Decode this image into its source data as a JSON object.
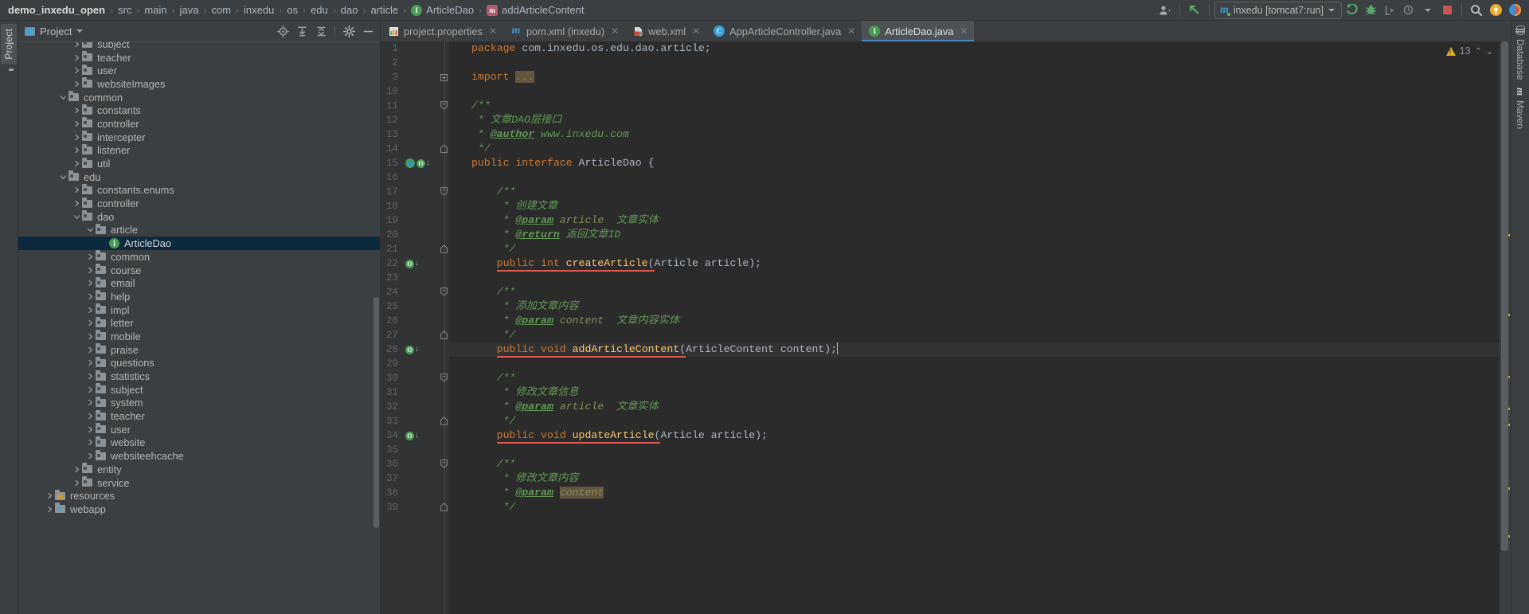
{
  "breadcrumb": {
    "items": [
      {
        "label": "demo_inxedu_open",
        "icon": "",
        "root": true
      },
      {
        "label": "src",
        "icon": ""
      },
      {
        "label": "main",
        "icon": ""
      },
      {
        "label": "java",
        "icon": ""
      },
      {
        "label": "com",
        "icon": ""
      },
      {
        "label": "inxedu",
        "icon": ""
      },
      {
        "label": "os",
        "icon": ""
      },
      {
        "label": "edu",
        "icon": ""
      },
      {
        "label": "dao",
        "icon": ""
      },
      {
        "label": "article",
        "icon": ""
      },
      {
        "label": "ArticleDao",
        "icon": "interface-icon",
        "glyph": "I"
      },
      {
        "label": "addArticleContent",
        "icon": "method-icon",
        "glyph": "m"
      }
    ],
    "separator": "›"
  },
  "toolbar": {
    "user_icon": "user-avatar-icon",
    "vcs_update_icon": "vcs-update-arrow-icon",
    "run_config": {
      "prefix_icon": "maven-icon",
      "label": "inxedu [tomcat7:run]",
      "dropdown": "▾"
    },
    "buttons": [
      {
        "name": "run-button",
        "glyph": "run"
      },
      {
        "name": "debug-button",
        "glyph": "debug"
      },
      {
        "name": "run-with-coverage-button",
        "glyph": "coverage"
      },
      {
        "name": "profile-button",
        "glyph": "profile"
      },
      {
        "name": "stop-button",
        "glyph": "stop"
      },
      {
        "name": "search-everywhere-button",
        "glyph": "search"
      },
      {
        "name": "update-button",
        "glyph": "update"
      },
      {
        "name": "feedback-button",
        "glyph": "colorwheel"
      }
    ]
  },
  "left_strip": {
    "tab_label": "Project",
    "folder_icon": "folder-icon"
  },
  "project_panel": {
    "title": "Project",
    "dropdown": "▾",
    "header_buttons": [
      {
        "name": "locate-button",
        "title": "Select Opened File"
      },
      {
        "name": "expand-all-button",
        "title": "Expand All"
      },
      {
        "name": "collapse-all-button",
        "title": "Collapse All"
      },
      {
        "name": "settings-button",
        "title": "Settings"
      },
      {
        "name": "hide-button",
        "title": "Hide"
      }
    ],
    "tree": [
      {
        "label": "subject",
        "indent": 4,
        "arrow": "right",
        "icon": "folder",
        "partial": true
      },
      {
        "label": "teacher",
        "indent": 4,
        "arrow": "right",
        "icon": "folder"
      },
      {
        "label": "user",
        "indent": 4,
        "arrow": "right",
        "icon": "folder"
      },
      {
        "label": "websiteImages",
        "indent": 4,
        "arrow": "right",
        "icon": "folder"
      },
      {
        "label": "common",
        "indent": 3,
        "arrow": "down",
        "icon": "folder"
      },
      {
        "label": "constants",
        "indent": 4,
        "arrow": "right",
        "icon": "folder"
      },
      {
        "label": "controller",
        "indent": 4,
        "arrow": "right",
        "icon": "folder"
      },
      {
        "label": "intercepter",
        "indent": 4,
        "arrow": "right",
        "icon": "folder"
      },
      {
        "label": "listener",
        "indent": 4,
        "arrow": "right",
        "icon": "folder"
      },
      {
        "label": "util",
        "indent": 4,
        "arrow": "right",
        "icon": "folder"
      },
      {
        "label": "edu",
        "indent": 3,
        "arrow": "down",
        "icon": "folder"
      },
      {
        "label": "constants.enums",
        "indent": 4,
        "arrow": "right",
        "icon": "folder"
      },
      {
        "label": "controller",
        "indent": 4,
        "arrow": "right",
        "icon": "folder"
      },
      {
        "label": "dao",
        "indent": 4,
        "arrow": "down",
        "icon": "folder"
      },
      {
        "label": "article",
        "indent": 5,
        "arrow": "down",
        "icon": "folder"
      },
      {
        "label": "ArticleDao",
        "indent": 6,
        "arrow": "none",
        "icon": "interface",
        "selected": true
      },
      {
        "label": "common",
        "indent": 5,
        "arrow": "right",
        "icon": "folder"
      },
      {
        "label": "course",
        "indent": 5,
        "arrow": "right",
        "icon": "folder"
      },
      {
        "label": "email",
        "indent": 5,
        "arrow": "right",
        "icon": "folder"
      },
      {
        "label": "help",
        "indent": 5,
        "arrow": "right",
        "icon": "folder"
      },
      {
        "label": "impl",
        "indent": 5,
        "arrow": "right",
        "icon": "folder"
      },
      {
        "label": "letter",
        "indent": 5,
        "arrow": "right",
        "icon": "folder"
      },
      {
        "label": "mobile",
        "indent": 5,
        "arrow": "right",
        "icon": "folder"
      },
      {
        "label": "praise",
        "indent": 5,
        "arrow": "right",
        "icon": "folder"
      },
      {
        "label": "questions",
        "indent": 5,
        "arrow": "right",
        "icon": "folder"
      },
      {
        "label": "statistics",
        "indent": 5,
        "arrow": "right",
        "icon": "folder"
      },
      {
        "label": "subject",
        "indent": 5,
        "arrow": "right",
        "icon": "folder"
      },
      {
        "label": "system",
        "indent": 5,
        "arrow": "right",
        "icon": "folder"
      },
      {
        "label": "teacher",
        "indent": 5,
        "arrow": "right",
        "icon": "folder"
      },
      {
        "label": "user",
        "indent": 5,
        "arrow": "right",
        "icon": "folder"
      },
      {
        "label": "website",
        "indent": 5,
        "arrow": "right",
        "icon": "folder"
      },
      {
        "label": "websiteehcache",
        "indent": 5,
        "arrow": "right",
        "icon": "folder"
      },
      {
        "label": "entity",
        "indent": 4,
        "arrow": "right",
        "icon": "folder"
      },
      {
        "label": "service",
        "indent": 4,
        "arrow": "right",
        "icon": "folder"
      },
      {
        "label": "resources",
        "indent": 2,
        "arrow": "right",
        "icon": "resources"
      },
      {
        "label": "webapp",
        "indent": 2,
        "arrow": "right",
        "icon": "webapp"
      }
    ]
  },
  "editor_tabs": [
    {
      "label": "project.properties",
      "icon": "properties-file-icon",
      "active": false,
      "closable": true
    },
    {
      "label": "pom.xml (inxedu)",
      "icon": "maven-file-icon",
      "active": false,
      "closable": true
    },
    {
      "label": "web.xml",
      "icon": "xml-file-icon",
      "active": false,
      "closable": true
    },
    {
      "label": "AppArticleController.java",
      "icon": "class-file-icon",
      "active": false,
      "closable": true
    },
    {
      "label": "ArticleDao.java",
      "icon": "interface-file-icon",
      "active": true,
      "closable": true
    }
  ],
  "inspection": {
    "warning_count": "13",
    "icon": "warning-triangle-icon",
    "prev": "⌃",
    "next": "⌄"
  },
  "right_strip": [
    {
      "label": "Database",
      "icon": "database-icon"
    },
    {
      "label": "Maven",
      "icon": "maven-icon"
    }
  ],
  "code": {
    "file": "ArticleDao.java",
    "current_line": 28,
    "lines": [
      {
        "n": 1,
        "html": "<span class=\"kw\">package</span> com.inxedu.os.edu.dao.article;"
      },
      {
        "n": 2,
        "html": ""
      },
      {
        "n": 3,
        "html": "<span class=\"kw\">import</span> <span class=\"hl\">...</span>",
        "fold": "plus"
      },
      {
        "n": 10,
        "html": ""
      },
      {
        "n": 11,
        "html": "<span class=\"cm\">/**</span>",
        "fold": "start"
      },
      {
        "n": 12,
        "html": "<span class=\"cm\"> * 文章DAO层接口</span>"
      },
      {
        "n": 13,
        "html": "<span class=\"cm\"> * <span class=\"tag\">@author</span> www.inxedu.com</span>"
      },
      {
        "n": 14,
        "html": "<span class=\"cm\"> */</span>",
        "fold": "end"
      },
      {
        "n": 15,
        "html": "<span class=\"kw\">public interface</span> <span class=\"id\">ArticleDao</span> {",
        "gutter": "bean-impl"
      },
      {
        "n": 16,
        "html": ""
      },
      {
        "n": 17,
        "html": "    <span class=\"cm\">/**</span>",
        "fold": "start"
      },
      {
        "n": 18,
        "html": "     <span class=\"cm\">* 创建文章</span>"
      },
      {
        "n": 19,
        "html": "     <span class=\"cm\">* <span class=\"tag\">@param</span> <span class=\"pv\">article</span>  文章实体</span>"
      },
      {
        "n": 20,
        "html": "     <span class=\"cm\">* <span class=\"tag\">@return</span> 返回文章ID</span>"
      },
      {
        "n": 21,
        "html": "     <span class=\"cm\">*/</span>",
        "fold": "end"
      },
      {
        "n": 22,
        "html": "    <span class=\"err-u\"><span class=\"kw\">public int</span> <span class=\"mt\">createArticle</span>(</span>Article article);",
        "gutter": "impl"
      },
      {
        "n": 23,
        "html": ""
      },
      {
        "n": 24,
        "html": "    <span class=\"cm\">/**</span>",
        "fold": "start"
      },
      {
        "n": 25,
        "html": "     <span class=\"cm\">* 添加文章内容</span>"
      },
      {
        "n": 26,
        "html": "     <span class=\"cm\">* <span class=\"tag\">@param</span> <span class=\"pv\">content</span>  文章内容实体</span>"
      },
      {
        "n": 27,
        "html": "     <span class=\"cm\">*/</span>",
        "fold": "end"
      },
      {
        "n": 28,
        "html": "    <span class=\"err-u\"><span class=\"kw\">public void</span> <span class=\"mt\">addArticleContent</span>(</span>ArticleContent content);<span class=\"caret\"></span>",
        "gutter": "impl",
        "current": true
      },
      {
        "n": 29,
        "html": ""
      },
      {
        "n": 30,
        "html": "    <span class=\"cm\">/**</span>",
        "fold": "start"
      },
      {
        "n": 31,
        "html": "     <span class=\"cm\">* 修改文章信息</span>"
      },
      {
        "n": 32,
        "html": "     <span class=\"cm\">* <span class=\"tag\">@param</span> <span class=\"pv\">article</span>  文章实体</span>"
      },
      {
        "n": 33,
        "html": "     <span class=\"cm\">*/</span>",
        "fold": "end"
      },
      {
        "n": 34,
        "html": "    <span class=\"err-u\"><span class=\"kw\">public void</span> <span class=\"mt\">updateArticle</span>(</span>Article article);",
        "gutter": "impl"
      },
      {
        "n": 35,
        "html": ""
      },
      {
        "n": 36,
        "html": "    <span class=\"cm\">/**</span>",
        "fold": "start"
      },
      {
        "n": 37,
        "html": "     <span class=\"cm\">* 修改文章内容</span>"
      },
      {
        "n": 38,
        "html": "     <span class=\"cm\">* <span class=\"tag\">@param</span> <span class=\"hl\">content</span></span>"
      },
      {
        "n": 39,
        "html": "     <span class=\"cm\">*/</span>",
        "fold": "end"
      }
    ]
  },
  "stripe_markers": [
    242,
    342,
    420,
    460,
    480,
    560,
    620
  ],
  "colors": {
    "chrome": "#3c3f41",
    "editor_bg": "#2b2b2b",
    "gutter_bg": "#313335",
    "keyword": "#cc7832",
    "comment": "#629755",
    "method": "#ffc66d",
    "identifier": "#a9b7c6",
    "selection": "#0d293e",
    "error_underline": "#e05a52",
    "warning": "#d4a017",
    "tab_underline": "#4a88c7"
  }
}
